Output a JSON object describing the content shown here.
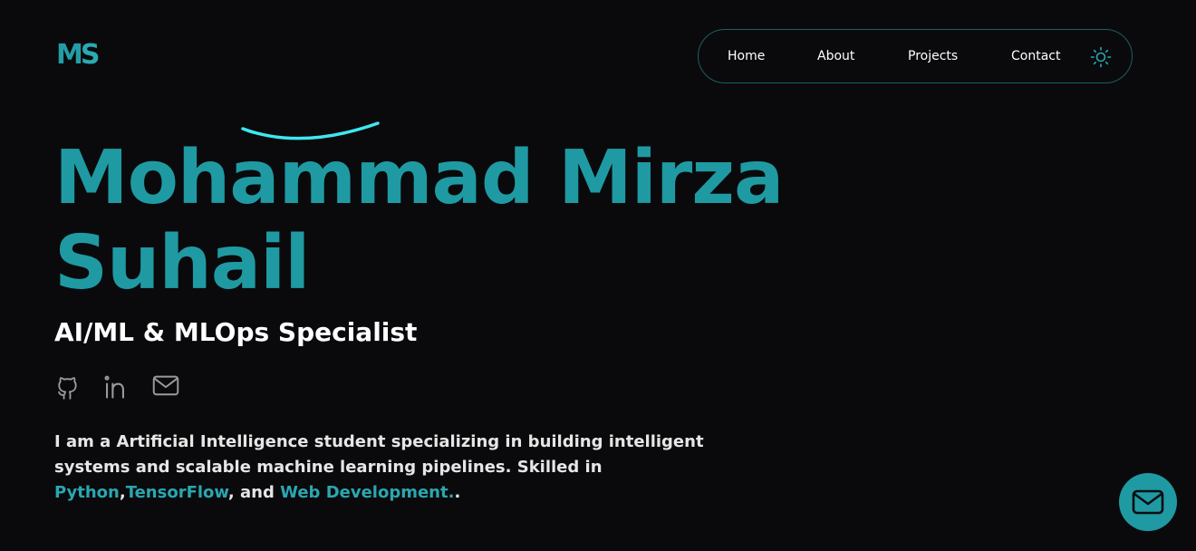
{
  "logo": {
    "m": "M",
    "s": "S"
  },
  "nav": {
    "items": [
      {
        "label": "Home"
      },
      {
        "label": "About"
      },
      {
        "label": "Projects"
      },
      {
        "label": "Contact"
      }
    ],
    "theme_icon": "sun-icon"
  },
  "hero": {
    "name_line1": "Mohammad Mirza",
    "name_line2": "Suhail",
    "role": "AI/ML & MLOps Specialist",
    "socials": [
      "github-icon",
      "linkedin-icon",
      "mail-icon"
    ],
    "bio": {
      "text": "I am a Artificial Intelligence student specializing in building intelligent systems and scalable machine learning pipelines. Skilled in",
      "skill1": "Python",
      "sep1": ",",
      "skill2": "TensorFlow",
      "sep2": ", and",
      "skill3": "Web Development.",
      "end": "."
    }
  },
  "fab": {
    "icon": "mail-icon"
  },
  "colors": {
    "background": "#0a0a0c",
    "accent": "#1f9aa3",
    "nav_border": "#1b5f63",
    "text": "#ffffff"
  }
}
